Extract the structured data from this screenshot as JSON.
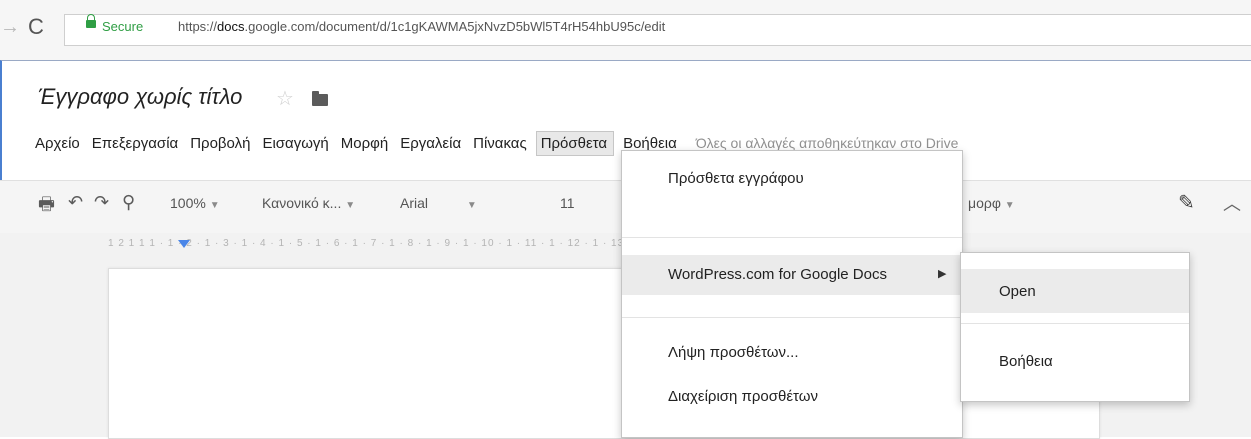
{
  "browser": {
    "secure_label": "Secure",
    "url_prefix": "https://",
    "url_host": "docs",
    "url_rest": ".google.com/document/d/1c1gKAWMA5jxNvzD5bWl5T4rH54hbU95c/edit"
  },
  "doc": {
    "title": "Έγγραφο χωρίς τίτλο"
  },
  "menubar": {
    "items": [
      "Αρχείο",
      "Επεξεργασία",
      "Προβολή",
      "Εισαγωγή",
      "Μορφή",
      "Εργαλεία",
      "Πίνακας",
      "Πρόσθετα",
      "Βοήθεια"
    ],
    "last_edit": "Όλες οι αλλαγές αποθηκεύτηκαν στο Drive"
  },
  "toolbar": {
    "zoom": "100%",
    "style": "Κανονικό κ...",
    "font": "Arial",
    "size": "11",
    "more": "μορφ"
  },
  "ruler": {
    "text": "1 2 1 1 1 · 1 · 2 · 1 · 3 · 1 · 4 · 1 · 5 · 1 · 6 · 1 · 7 · 1 · 8 · 1 · 9 · 1 · 10 · 1 · 11 · 1 · 12 · 1 · 13 · 1 · 14 · 1 · 15 · 1 · 16 · 1 · 17 · 1 · 18"
  },
  "dropdown": {
    "items": [
      {
        "label": "Πρόσθετα εγγράφου"
      },
      {
        "label": "WordPress.com for Google Docs",
        "has_submenu": true
      },
      {
        "label": "Λήψη προσθέτων..."
      },
      {
        "label": "Διαχείριση προσθέτων"
      }
    ]
  },
  "submenu": {
    "items": [
      {
        "label": "Open"
      },
      {
        "label": "Βοήθεια"
      }
    ]
  },
  "colors": {
    "secure_green": "#2f9e44",
    "accent_blue": "#4a7fd0"
  }
}
